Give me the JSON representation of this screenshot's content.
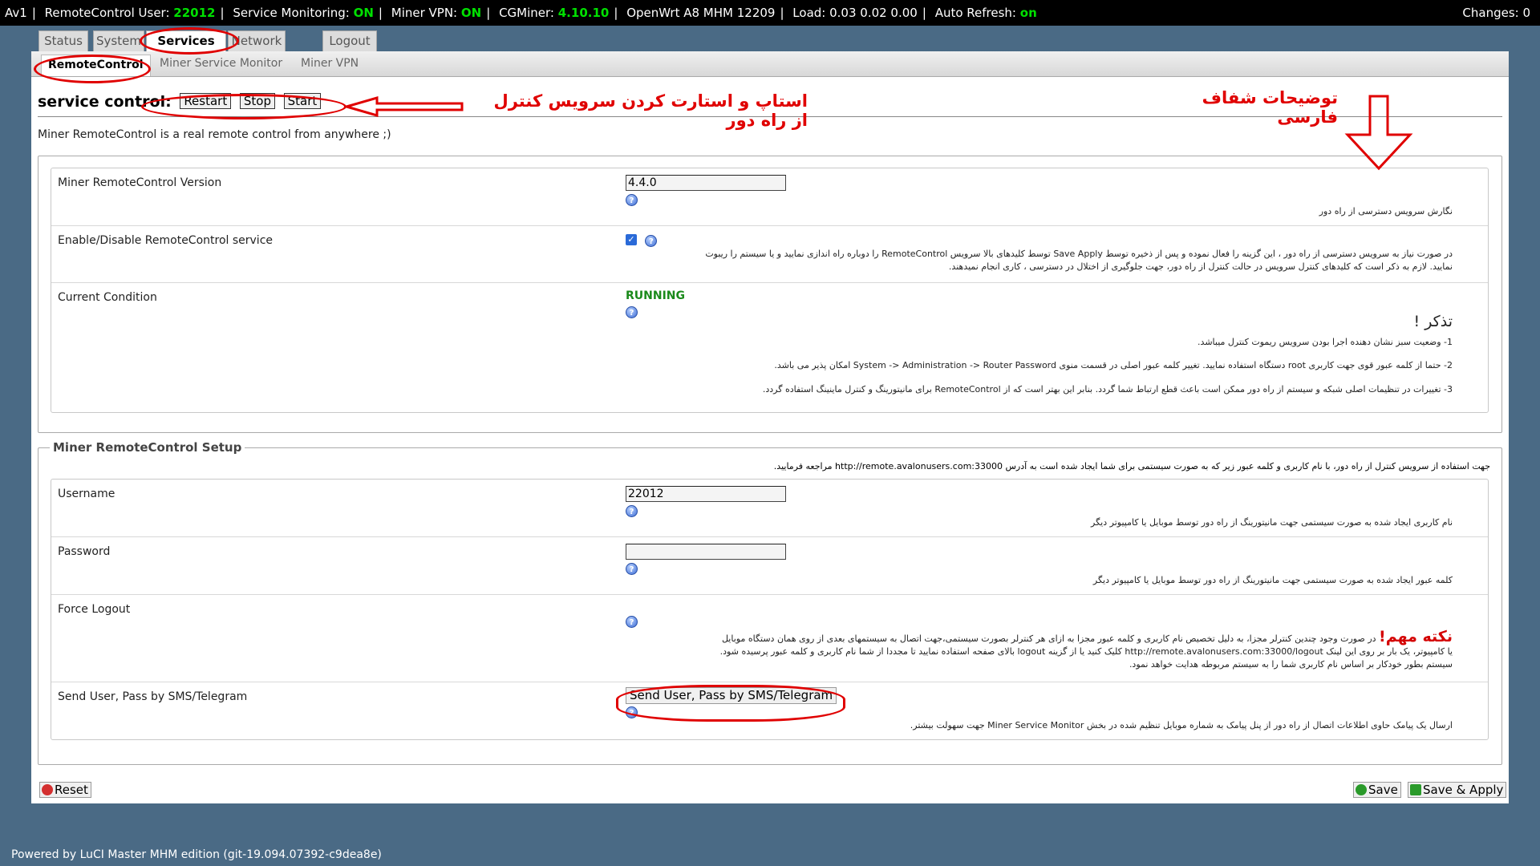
{
  "topbar": {
    "host": "Av1",
    "rc_user_label": "RemoteControl User:",
    "rc_user_value": "22012",
    "monitoring_label": "Service Monitoring:",
    "monitoring_value": "ON",
    "vpn_label": "Miner VPN:",
    "vpn_value": "ON",
    "cgminer_label": "CGMiner:",
    "cgminer_value": "4.10.10",
    "firmware": "OpenWrt A8 MHM 12209",
    "load": "Load: 0.03 0.02 0.00",
    "auto_refresh_label": "Auto Refresh:",
    "auto_refresh_value": "on",
    "changes": "Changes: 0",
    "on_color": "#00e000"
  },
  "tabs": [
    "Status",
    "System",
    "Services",
    "Network",
    "Logout"
  ],
  "subtabs": [
    "RemoteControl",
    "Miner Service Monitor",
    "Miner VPN"
  ],
  "service_control": {
    "label": "service control:",
    "restart": "Restart",
    "stop": "Stop",
    "start": "Start"
  },
  "annotations": {
    "arrow_note": "استاپ و استارت کردن سرویس کنترل از راه دور",
    "desc_note": "توضیحات شفاف فارسی",
    "reminder_title": "تذکر !",
    "important_title": "نکته مهم!"
  },
  "description": "Miner RemoteControl is a real remote control from anywhere ;)",
  "section1": {
    "rows": [
      {
        "label": "Miner RemoteControl Version",
        "value": "4.4.0",
        "fa": "نگارش سرویس دسترسی از راه دور"
      },
      {
        "label": "Enable/Disable RemoteControl service",
        "fa1": "در صورت نیاز به سرویس دسترسی از راه دور ، این گزینه را فعال نموده و پس از ذخیره توسط Save Apply توسط کلیدهای بالا سرویس RemoteControl را دوباره راه اندازی نمایید و یا سیستم را ریبوت",
        "fa2": "نمایید. لازم به ذکر است که کلیدهای کنترل سرویس در حالت کنترل از راه دور، جهت جلوگیری از اختلال در دسترسی ، کاری انجام نمیدهند."
      },
      {
        "label": "Current Condition",
        "value": "RUNNING",
        "fa1": "1- وضعیت سبز نشان دهنده اجرا بودن سرویس ریموت کنترل میباشد.",
        "fa2": "2- حتما از کلمه عبور قوی جهت کاربری root دستگاه استفاده نمایید. تغییر کلمه عبور اصلی در قسمت منوی System -> Administration -> Router Password امکان پذیر می باشد.",
        "fa3": "3- تغییرات در تنظیمات اصلی شبکه و سیستم از راه دور ممکن است باعث قطع ارتباط شما گردد. بنابر این بهتر است که از RemoteControl برای مانیتورینگ و کنترل ماینینگ استفاده گردد."
      }
    ]
  },
  "section2": {
    "legend": "Miner RemoteControl Setup",
    "intro": "جهت استفاده از سرویس کنترل از راه دور، با نام کاربری و کلمه عبور زیر که به صورت سیستمی برای شما ایجاد شده است به آدرس http://remote.avalonusers.com:33000 مراجعه فرمایید.",
    "rows": [
      {
        "label": "Username",
        "value": "22012",
        "fa": "نام کاربری ایجاد شده به صورت سیستمی جهت مانیتورینگ از راه دور توسط موبایل یا کامپیوتر دیگر"
      },
      {
        "label": "Password",
        "fa": "کلمه عبور ایجاد شده به صورت سیستمی جهت مانیتورینگ از راه دور توسط موبایل یا کامپیوتر دیگر"
      },
      {
        "label": "Force Logout",
        "fa1": "در صورت وجود چندین کنترلر مجزا، به دلیل تخصیص نام کاربری و کلمه عبور مجزا به ازای هر کنترلر بصورت سیستمی،جهت اتصال به سیستمهای بعدی از روی همان دستگاه موبایل",
        "fa2": "یا کامپیوتر، یک بار بر روی این لینک http://remote.avalonusers.com:33000/logout کلیک کنید یا از گزینه logout بالای صفحه استفاده نمایید تا مجددا از شما نام کاربری و کلمه عبور پرسیده شود.",
        "fa3": "سیستم بطور خودکار بر اساس نام کاربری شما را به سیستم مربوطه هدایت خواهد نمود."
      },
      {
        "label": "Send User, Pass by SMS/Telegram",
        "button": "Send User, Pass by SMS/Telegram",
        "fa": "ارسال یک پیامک حاوی اطلاعات اتصال از راه دور از پنل پیامک به شماره موبایل تنظیم شده در بخش Miner Service Monitor جهت سهولت بیشتر."
      }
    ]
  },
  "buttons": {
    "reset": "Reset",
    "save": "Save",
    "save_apply": "Save & Apply"
  },
  "footer": "Powered by LuCI Master MHM edition (git-19.094.07392-c9dea8e)",
  "help_glyph": "?"
}
